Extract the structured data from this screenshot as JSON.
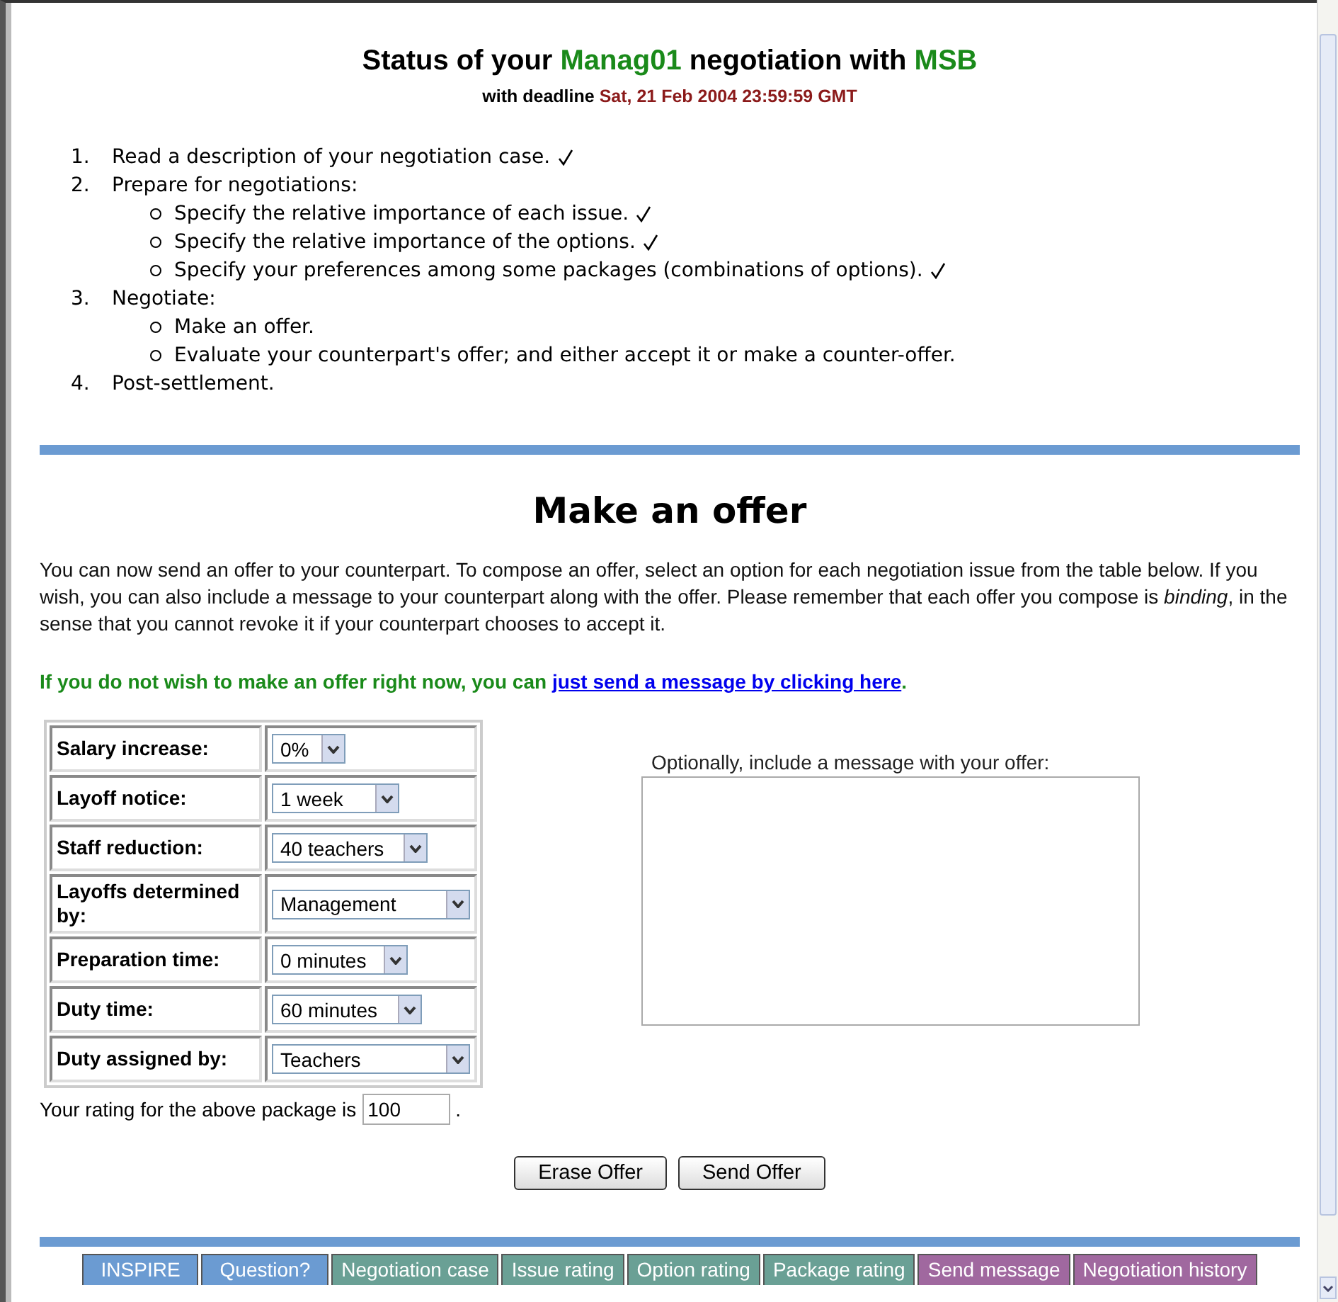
{
  "header": {
    "title_before": "Status of your",
    "user": "Manag01",
    "title_middle": "negotiation with",
    "counterpart": "MSB",
    "deadline_label": "with deadline",
    "deadline": "Sat, 21 Feb 2004 23:59:59 GMT"
  },
  "steps": [
    {
      "number": "1.",
      "text": "Read a description of your negotiation case.",
      "done": true
    },
    {
      "number": "2.",
      "text": "Prepare for negotiations:",
      "done": false,
      "children": [
        {
          "text": "Specify the relative importance of each issue.",
          "done": true
        },
        {
          "text": "Specify the relative importance of the options.",
          "done": true
        },
        {
          "text": "Specify your preferences among some packages (combinations of options).",
          "done": true
        }
      ]
    },
    {
      "number": "3.",
      "text": "Negotiate:",
      "done": false,
      "children": [
        {
          "text": "Make an offer.",
          "done": false
        },
        {
          "text": "Evaluate your counterpart's offer; and either accept it or make a counter-offer.",
          "done": false
        }
      ]
    },
    {
      "number": "4.",
      "text": "Post-settlement.",
      "done": false
    }
  ],
  "offer": {
    "heading": "Make an offer",
    "intro": "You can now send an offer to your counterpart. To compose an offer, select an option for each negotiation issue from the table below. If you wish, you can also include a message to your counterpart along with the offer. Please remember that each offer you compose is *binding*, in the sense that you cannot revoke it if your counterpart chooses to accept it.",
    "notice": "If you do not wish to make an offer right now, you can",
    "notice_link": "just send a message by clicking here",
    "notice_end": ".",
    "issues": [
      {
        "label": "Salary increase:",
        "value": "0%"
      },
      {
        "label": "Layoff notice:",
        "value": "1 week"
      },
      {
        "label": "Staff reduction:",
        "value": "40 teachers"
      },
      {
        "label": "Layoffs determined by:",
        "value": "Management"
      },
      {
        "label": "Preparation time:",
        "value": "0 minutes"
      },
      {
        "label": "Duty time:",
        "value": "60 minutes"
      },
      {
        "label": "Duty assigned by:",
        "value": "Teachers"
      }
    ],
    "message_label": "Optionally, include a message with your offer:",
    "rating_label": "Your rating for the above package is",
    "rating": "100",
    "rating_end": ".",
    "buttons": [
      "Erase Offer",
      "Send Offer"
    ]
  },
  "nav": [
    {
      "label": "INSPIRE",
      "color": "#6b9bd2"
    },
    {
      "label": "Question?",
      "color": "#6b9bd2"
    },
    {
      "label": "Negotiation case",
      "color": "#6aa095"
    },
    {
      "label": "Issue rating",
      "color": "#6aa095"
    },
    {
      "label": "Option rating",
      "color": "#6aa095"
    },
    {
      "label": "Package rating",
      "color": "#6aa095"
    },
    {
      "label": "Send message",
      "color": "#a0689f"
    },
    {
      "label": "Negotiation history",
      "color": "#a0689f"
    }
  ]
}
